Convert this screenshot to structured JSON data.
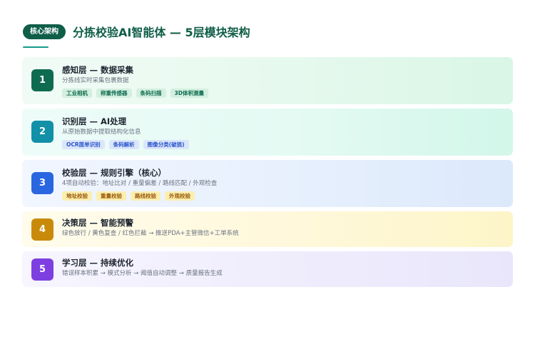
{
  "header": {
    "badge": "核心架构",
    "title": "分拣校验AI智能体 — 5层模块架构"
  },
  "layers": [
    {
      "number": "1",
      "title": "感知层 — 数据采集",
      "description": "分拣线实时采集包裹数据",
      "tags": [
        "工业相机",
        "称重传感器",
        "条码扫描",
        "3D体积测量"
      ]
    },
    {
      "number": "2",
      "title": "识别层 — AI处理",
      "description": "从原始数据中提取结构化信息",
      "tags": [
        "OCR面单识别",
        "条码解析",
        "图像分类(破损)"
      ]
    },
    {
      "number": "3",
      "title": "校验层 — 规则引擎（核心）",
      "description": "4项自动校验：地址比对 / 重量偏差 / 路线匹配 / 外观检查",
      "tags": [
        "地址校验",
        "重量校验",
        "路线校验",
        "外观校验"
      ]
    },
    {
      "number": "4",
      "title": "决策层 — 智能预警",
      "description": "绿色放行 / 黄色复查 / 红色拦截 → 推送PDA+主管微信+工单系统",
      "tags": []
    },
    {
      "number": "5",
      "title": "学习层 — 持续优化",
      "description": "错误样本积累 → 模式分析 → 阈值自动调整 → 质量报告生成",
      "tags": []
    }
  ]
}
